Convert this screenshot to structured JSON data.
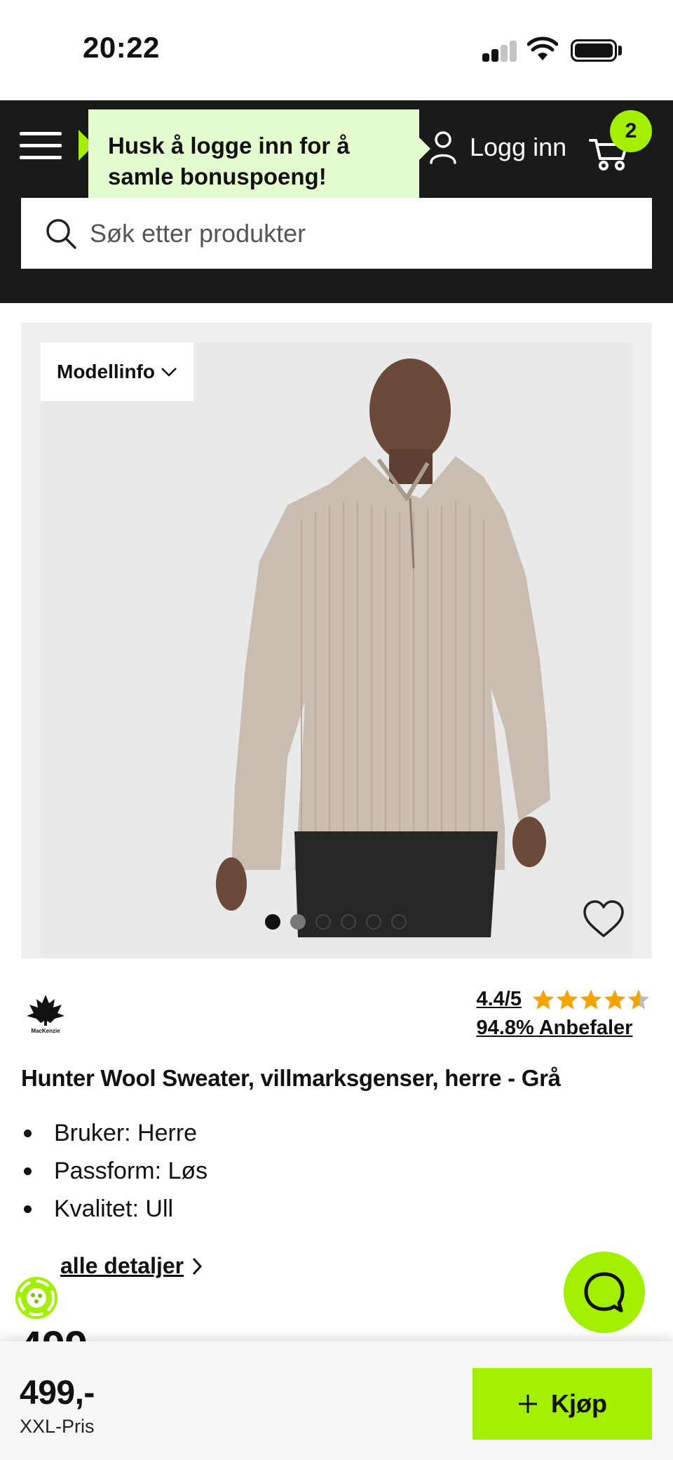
{
  "status_bar": {
    "time": "20:22"
  },
  "header": {
    "login_label": "Logg inn",
    "cart_count": "2",
    "tooltip": "Husk å logge inn for å samle bonuspoeng!",
    "accent": "#a2f000"
  },
  "search": {
    "placeholder": "Søk etter produkter"
  },
  "gallery": {
    "model_info_label": "Modellinfo",
    "image_count": 6,
    "active_index": 0
  },
  "product": {
    "brand": "MacKenzie",
    "rating": "4.4/5",
    "rating_value": 4.4,
    "recommend": "94.8% Anbefaler",
    "title": "Hunter Wool Sweater, villmarksgenser, herre - Grå",
    "features": [
      "Bruker: Herre",
      "Passform: Løs",
      "Kvalitet: Ull"
    ],
    "details_link": "alle detaljer",
    "peek_price": "499,-"
  },
  "bottom_bar": {
    "price": "499,-",
    "price_label": "XXL-Pris",
    "buy_label": "Kjøp"
  },
  "icons": [
    "menu-icon",
    "user-icon",
    "cart-icon",
    "search-icon",
    "chevron-down-icon",
    "heart-icon",
    "star-icon",
    "chevron-right-icon",
    "chat-icon",
    "plus-icon",
    "eco-icon"
  ]
}
